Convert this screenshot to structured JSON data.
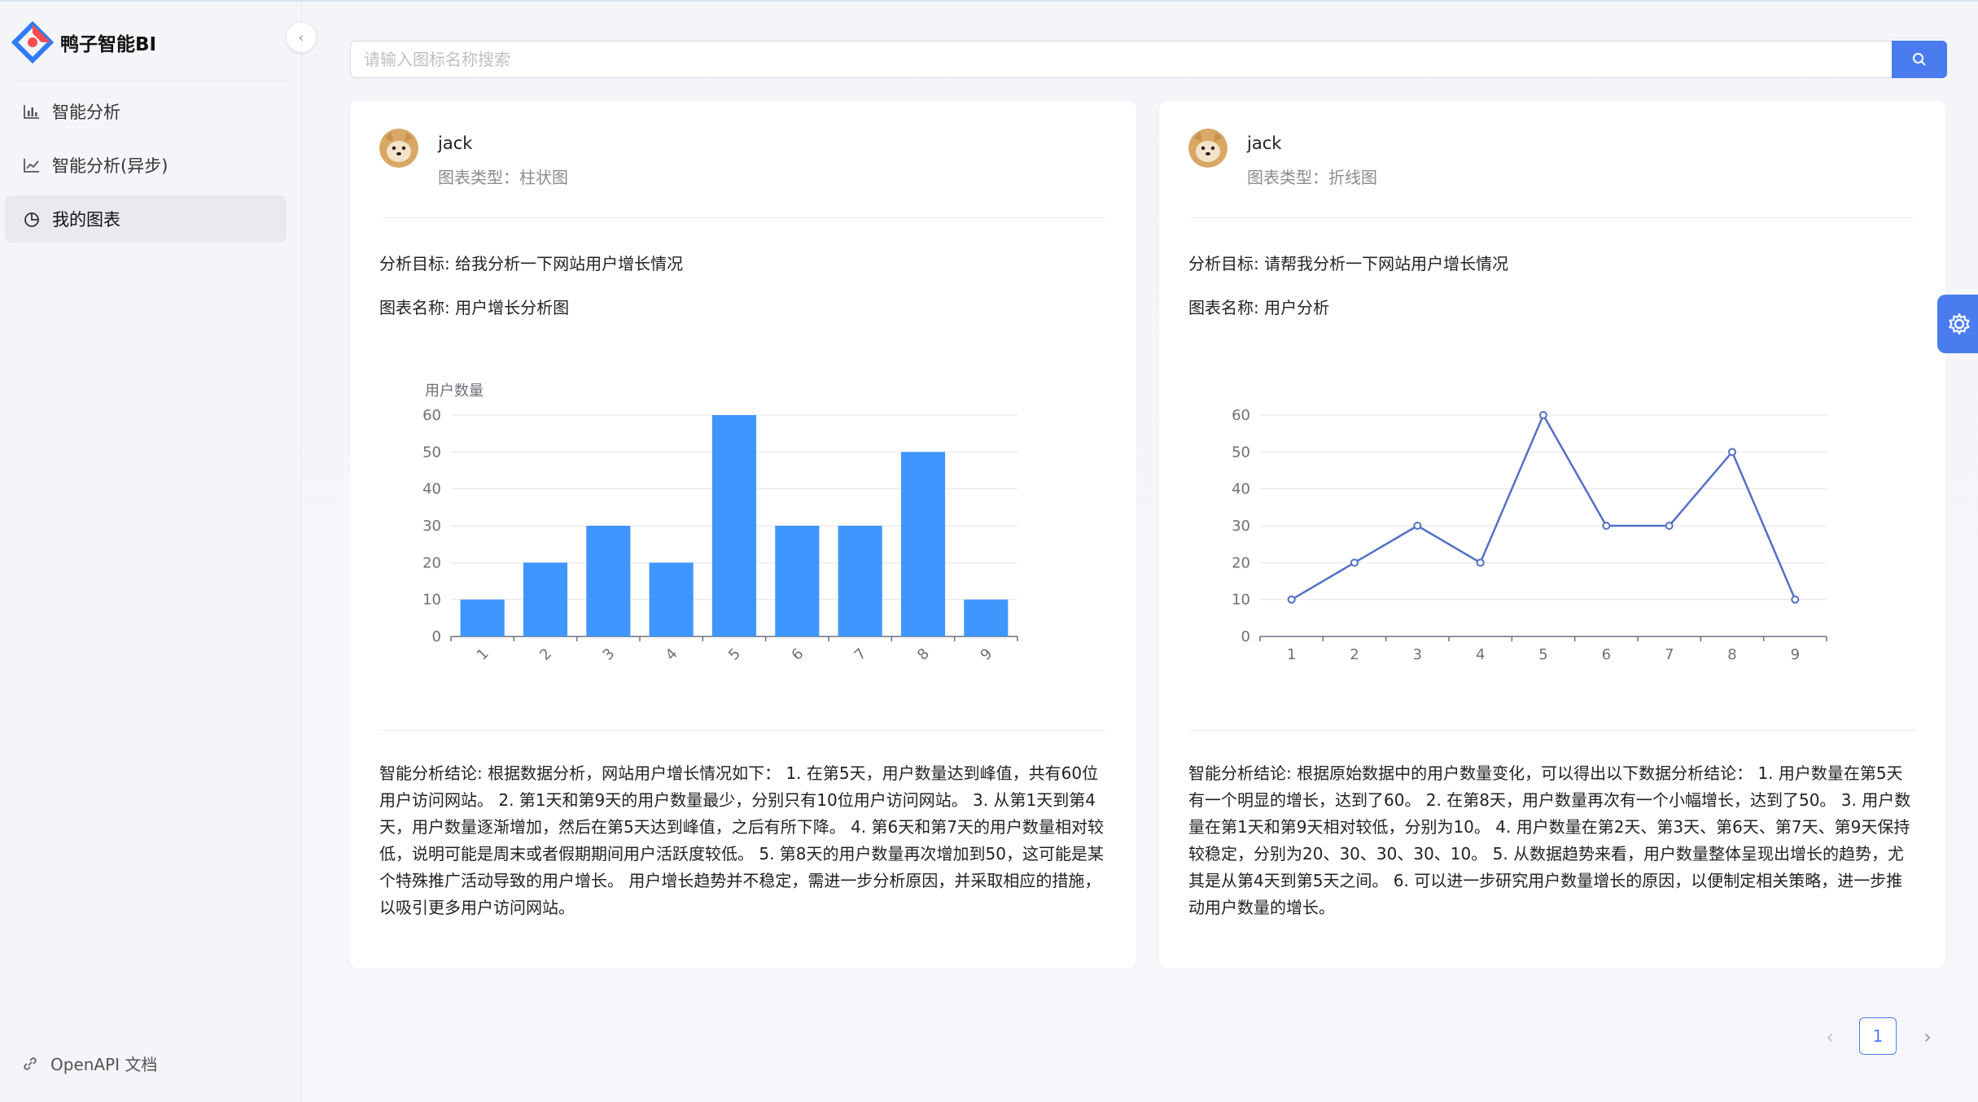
{
  "app": {
    "title": "鸭子智能BI"
  },
  "sidebar": {
    "items": [
      {
        "label": "智能分析",
        "icon": "bar-chart-icon"
      },
      {
        "label": "智能分析(异步)",
        "icon": "line-chart-icon"
      },
      {
        "label": "我的图表",
        "icon": "pie-chart-icon",
        "active": true
      }
    ],
    "footer_link": "OpenAPI 文档"
  },
  "search": {
    "placeholder": "请输入图标名称搜索",
    "value": ""
  },
  "cards": [
    {
      "user": "jack",
      "chart_type_label": "图表类型：柱状图",
      "goal": "分析目标: 给我分析一下网站用户增长情况",
      "name": "图表名称: 用户增长分析图",
      "conclusion": "智能分析结论: 根据数据分析，网站用户增长情况如下： 1. 在第5天，用户数量达到峰值，共有60位用户访问网站。 2. 第1天和第9天的用户数量最少，分别只有10位用户访问网站。 3. 从第1天到第4天，用户数量逐渐增加，然后在第5天达到峰值，之后有所下降。 4. 第6天和第7天的用户数量相对较低，说明可能是周末或者假期期间用户活跃度较低。 5. 第8天的用户数量再次增加到50，这可能是某个特殊推广活动导致的用户增长。 用户增长趋势并不稳定，需进一步分析原因，并采取相应的措施，以吸引更多用户访问网站。"
    },
    {
      "user": "jack",
      "chart_type_label": "图表类型：折线图",
      "goal": "分析目标: 请帮我分析一下网站用户增长情况",
      "name": "图表名称: 用户分析",
      "conclusion": "智能分析结论: 根据原始数据中的用户数量变化，可以得出以下数据分析结论： 1. 用户数量在第5天有一个明显的增长，达到了60。 2. 在第8天，用户数量再次有一个小幅增长，达到了50。 3. 用户数量在第1天和第9天相对较低，分别为10。 4. 用户数量在第2天、第3天、第6天、第7天、第9天保持较稳定，分别为20、30、30、30、10。 5. 从数据趋势来看，用户数量整体呈现出增长的趋势，尤其是从第4天到第5天之间。 6. 可以进一步研究用户数量增长的原因，以便制定相关策略，进一步推动用户数量的增长。"
    }
  ],
  "chart_data": [
    {
      "type": "bar",
      "categories": [
        "1",
        "2",
        "3",
        "4",
        "5",
        "6",
        "7",
        "8",
        "9"
      ],
      "values": [
        10,
        20,
        30,
        20,
        60,
        30,
        30,
        50,
        10
      ],
      "title": "",
      "xlabel": "",
      "ylabel": "用户数量",
      "ylim": [
        0,
        60
      ],
      "yticks": [
        "0",
        "10",
        "20",
        "30",
        "40",
        "50",
        "60"
      ],
      "grid": true,
      "color": "#4096ff"
    },
    {
      "type": "line",
      "categories": [
        "1",
        "2",
        "3",
        "4",
        "5",
        "6",
        "7",
        "8",
        "9"
      ],
      "values": [
        10,
        20,
        30,
        20,
        60,
        30,
        30,
        50,
        10
      ],
      "title": "",
      "xlabel": "",
      "ylabel": "",
      "ylim": [
        0,
        60
      ],
      "yticks": [
        "0",
        "10",
        "20",
        "30",
        "40",
        "50",
        "60"
      ],
      "grid": true,
      "color": "#5470c6"
    }
  ],
  "pagination": {
    "prev": "‹",
    "current": "1",
    "next": "›"
  },
  "colors": {
    "accent": "#4a7cf0"
  }
}
